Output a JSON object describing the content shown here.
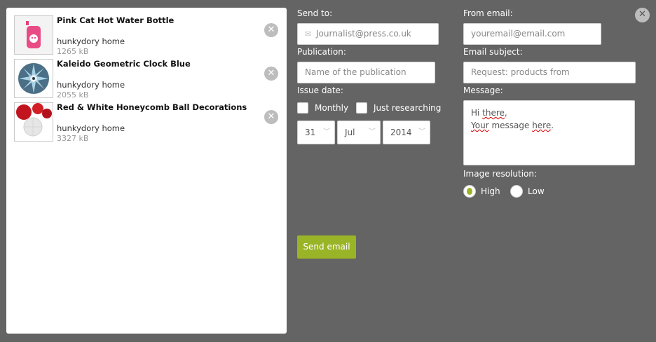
{
  "products": [
    {
      "name": "Pink Cat Hot Water Bottle",
      "brand": "hunkydory home",
      "size": "1265 kB",
      "thumb_icon": "pink-bottle-thumbnail"
    },
    {
      "name": "Kaleido Geometric Clock Blue",
      "brand": "hunkydory home",
      "size": "2055 kB",
      "thumb_icon": "clock-thumbnail"
    },
    {
      "name": "Red & White Honeycomb Ball Decorations",
      "brand": "hunkydory home",
      "size": "3327 kB",
      "thumb_icon": "honeycomb-thumbnail"
    }
  ],
  "form": {
    "send_to_label": "Send to:",
    "send_to_placeholder": "Journalist@press.co.uk",
    "publication_label": "Publication:",
    "publication_placeholder": "Name of the publication",
    "issue_date_label": "Issue date:",
    "monthly_label": "Monthly",
    "just_researching_label": "Just researching",
    "day": "31",
    "month": "Jul",
    "year": "2014",
    "from_email_label": "From email:",
    "from_email_placeholder": "youremail@email.com",
    "subject_label": "Email subject:",
    "subject_value": "Request: products from",
    "message_label": "Message:",
    "message_line1_a": "Hi ",
    "message_line1_b": "there",
    "message_line1_c": ",",
    "message_line2_a": "Your",
    "message_line2_b": " message ",
    "message_line2_c": "here",
    "message_line2_d": ".",
    "resolution_label": "Image resolution:",
    "resolution_high": "High",
    "resolution_low": "Low",
    "send_button": "Send email"
  },
  "colors": {
    "accent": "#9ab427",
    "background": "#646464"
  }
}
